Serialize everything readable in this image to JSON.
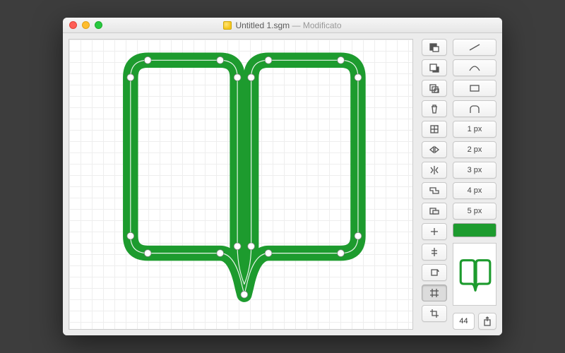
{
  "window": {
    "title": "Untitled 1.sgm",
    "modified_suffix": "— Modificato"
  },
  "accent_color": "#1d9b2e",
  "stroke_sizes": [
    "1 px",
    "2 px",
    "3 px",
    "4 px",
    "5 px"
  ],
  "icon_size_value": "44",
  "tool_buttons": [
    "bring-front",
    "send-back",
    "duplicate",
    "delete",
    "group",
    "flip-horizontal",
    "mirror",
    "union",
    "subtract",
    "intersect",
    "align-center",
    "rotate",
    "snap-grid",
    "crop"
  ],
  "shape_buttons": [
    "line",
    "curve",
    "rect",
    "rounded-rect"
  ]
}
